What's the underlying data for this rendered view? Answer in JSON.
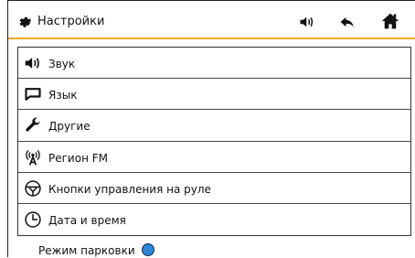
{
  "header": {
    "title": "Настройки"
  },
  "menu": {
    "items": [
      {
        "label": "Звук",
        "icon": "speaker-icon"
      },
      {
        "label": "Язык",
        "icon": "speech-bubble-icon"
      },
      {
        "label": "Другие",
        "icon": "wrench-icon"
      },
      {
        "label": "Регион FM",
        "icon": "antenna-icon"
      },
      {
        "label": "Кнопки управления на руле",
        "icon": "steering-wheel-icon"
      },
      {
        "label": "Дата и время",
        "icon": "clock-icon"
      }
    ]
  },
  "parking": {
    "label": "Режим парковки",
    "toggle_on": true,
    "toggle_color": "#2f86d6"
  },
  "colors": {
    "accent": "#f2a81d"
  }
}
